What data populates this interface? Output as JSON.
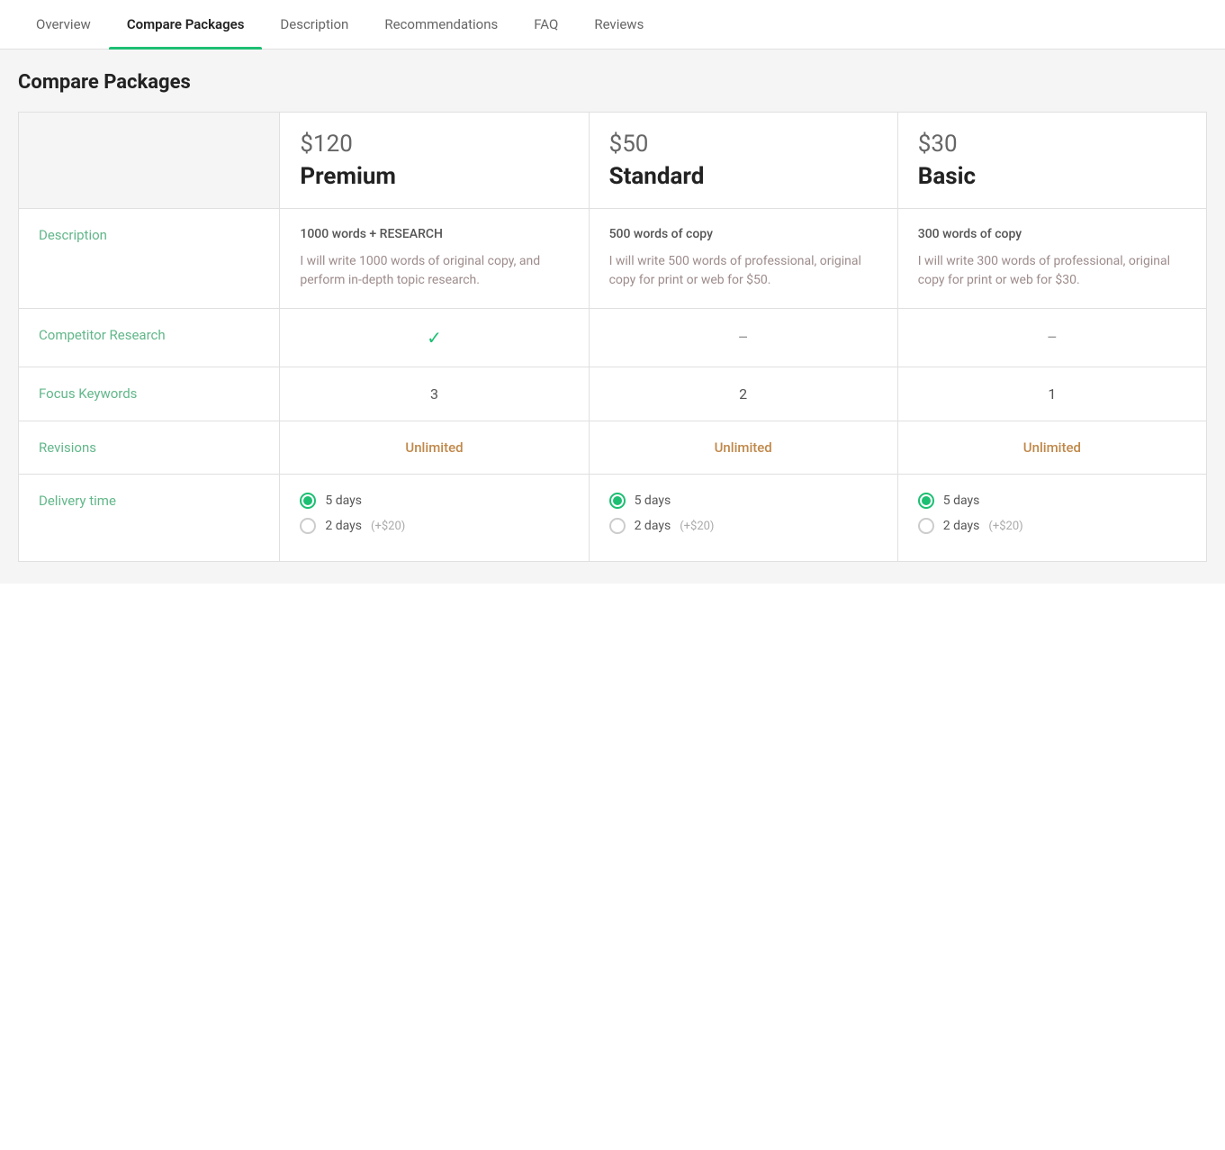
{
  "nav": {
    "tabs": [
      {
        "label": "Overview",
        "active": false
      },
      {
        "label": "Compare Packages",
        "active": true
      },
      {
        "label": "Description",
        "active": false
      },
      {
        "label": "Recommendations",
        "active": false
      },
      {
        "label": "FAQ",
        "active": false
      },
      {
        "label": "Reviews",
        "active": false
      }
    ]
  },
  "page": {
    "title": "Compare Packages"
  },
  "packages": {
    "premium": {
      "price": "$120",
      "name": "Premium",
      "description_main": "1000 words + RESEARCH",
      "description_detail": "I will write 1000 words of original copy, and perform in-depth topic research.",
      "competitor_research": "check",
      "focus_keywords": "3",
      "revisions": "Unlimited",
      "delivery_5days": "5 days",
      "delivery_2days": "2 days",
      "delivery_extra": "(+$20)"
    },
    "standard": {
      "price": "$50",
      "name": "Standard",
      "description_main": "500 words of copy",
      "description_detail": "I will write 500 words of professional, original copy for print or web for $50.",
      "competitor_research": "dash",
      "focus_keywords": "2",
      "revisions": "Unlimited",
      "delivery_5days": "5 days",
      "delivery_2days": "2 days",
      "delivery_extra": "(+$20)"
    },
    "basic": {
      "price": "$30",
      "name": "Basic",
      "description_main": "300 words of copy",
      "description_detail": "I will write 300 words of professional, original copy for print or web for $30.",
      "competitor_research": "dash",
      "focus_keywords": "1",
      "revisions": "Unlimited",
      "delivery_5days": "5 days",
      "delivery_2days": "2 days",
      "delivery_extra": "(+$20)"
    }
  },
  "labels": {
    "description": "Description",
    "competitor_research": "Competitor Research",
    "focus_keywords": "Focus Keywords",
    "revisions": "Revisions",
    "delivery_time": "Delivery time"
  }
}
